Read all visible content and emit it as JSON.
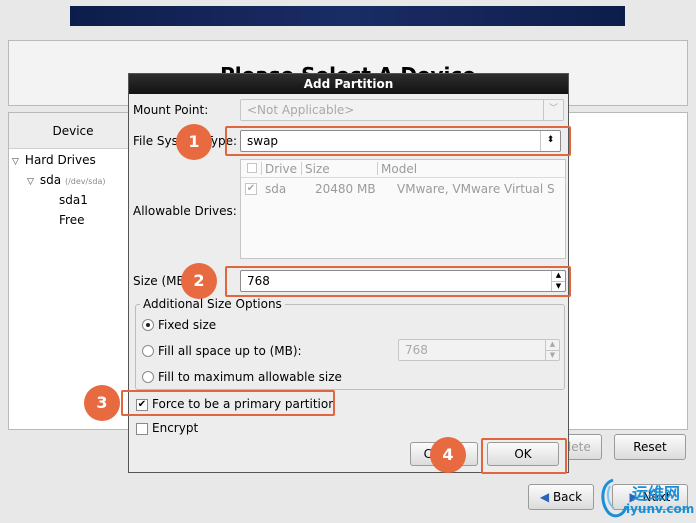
{
  "installer": {
    "heading": "Please Select A Device",
    "device_column": "Device",
    "tree": {
      "hard_drives": "Hard Drives",
      "sda": "sda",
      "sda_path": "(/dev/sda)",
      "sda1": "sda1",
      "free": "Free"
    },
    "buttons": {
      "delete": "Delete",
      "reset": "Reset",
      "back": "Back",
      "next": "Next"
    }
  },
  "dialog": {
    "title": "Add Partition",
    "mount_point_label": "Mount Point:",
    "mount_point_value": "<Not Applicable>",
    "fs_type_label": "File System Type:",
    "fs_type_value": "swap",
    "allowable_drives_label": "Allowable Drives:",
    "drives_columns": [
      "Drive",
      "Size",
      "Model"
    ],
    "drives_rows": [
      {
        "drive": "sda",
        "size": "20480 MB",
        "model": "VMware, VMware Virtual S",
        "checked": true
      }
    ],
    "size_label": "Size (MB):",
    "size_value": "768",
    "additional_options_legend": "Additional Size Options",
    "opt_fixed": "Fixed size",
    "opt_fill_upto": "Fill all space up to (MB):",
    "fill_upto_value": "768",
    "opt_fill_max": "Fill to maximum allowable size",
    "force_primary": "Force to be a primary partition",
    "force_primary_checked": true,
    "encrypt": "Encrypt",
    "encrypt_checked": false,
    "cancel": "Cancel",
    "ok": "OK"
  },
  "annotations": [
    "1",
    "2",
    "3",
    "4"
  ],
  "watermark": {
    "line1": "运维网",
    "line2": "iyunv.com"
  },
  "colors": {
    "annotation": "#e76a40",
    "banner": "#0d1d4a"
  }
}
